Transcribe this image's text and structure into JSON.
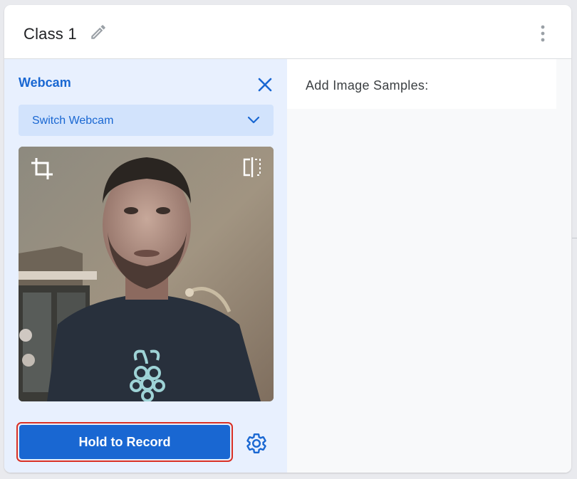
{
  "class_card": {
    "title": "Class 1",
    "edit_icon": "pencil-icon",
    "menu_icon": "more-vert-icon"
  },
  "webcam_panel": {
    "label": "Webcam",
    "close_icon": "close-icon",
    "switch_webcam_label": "Switch Webcam",
    "switch_icon": "chevron-down-icon",
    "crop_icon": "crop-icon",
    "flip_icon": "flip-horizontal-icon",
    "record_button_label": "Hold to Record",
    "settings_icon": "gear-icon"
  },
  "samples_panel": {
    "label": "Add Image Samples:"
  },
  "colors": {
    "accent": "#1967d2",
    "panel_bg": "#e8f0fe",
    "select_bg": "#d2e3fc",
    "highlight_border": "#d93025"
  }
}
